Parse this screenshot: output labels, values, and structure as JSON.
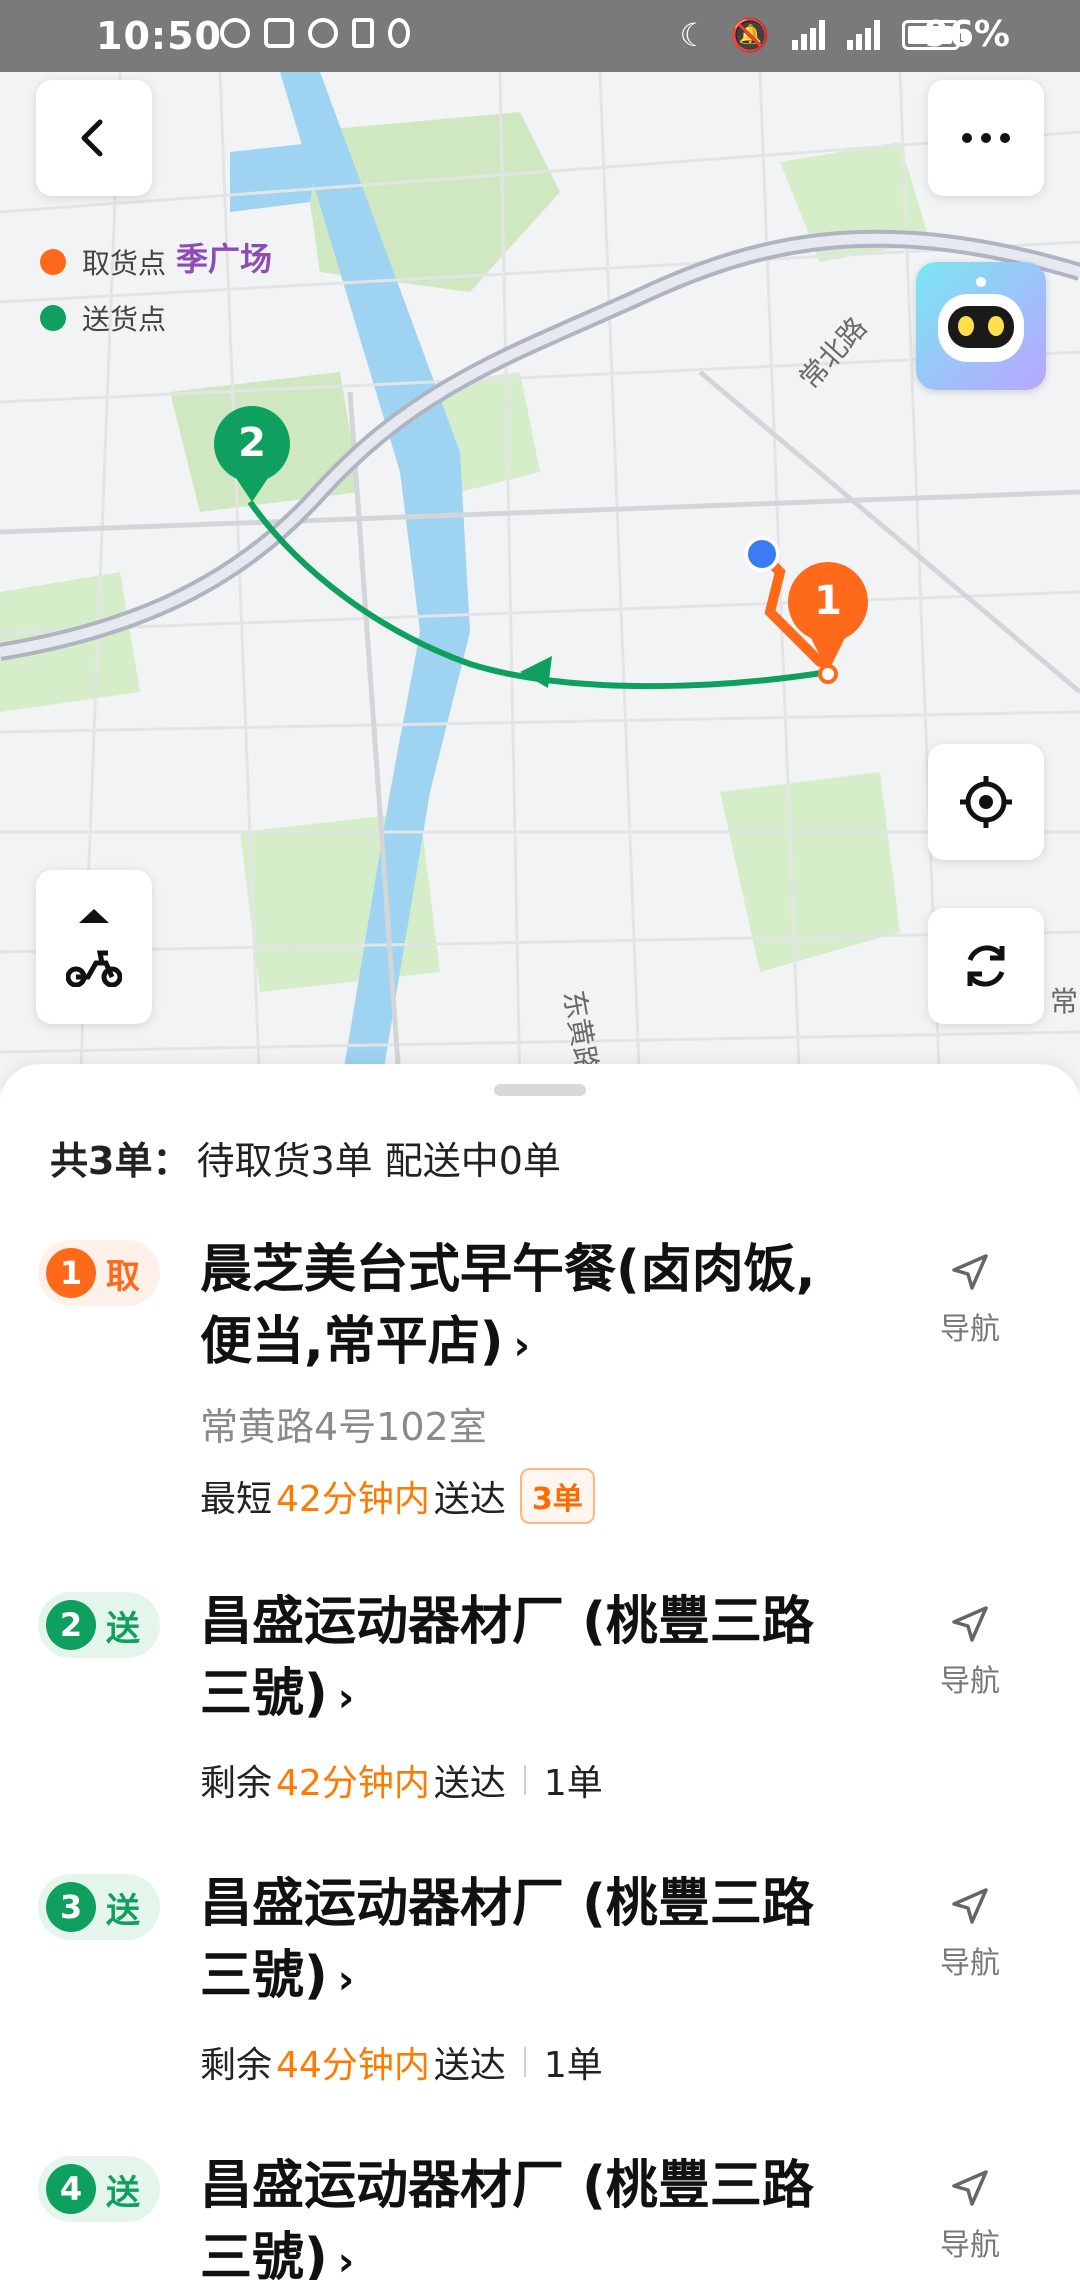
{
  "status_bar": {
    "time": "10:50",
    "battery": "96%"
  },
  "map": {
    "legend": {
      "pickup": "取货点",
      "delivery": "送货点"
    },
    "poi": "季广场",
    "road_labels": {
      "changbei": "常北路",
      "dongbei": "东黄路",
      "edge": "常"
    },
    "markers": [
      {
        "number": "1",
        "type": "pickup",
        "color": "#ff6a1a"
      },
      {
        "number": "2",
        "type": "delivery",
        "color": "#0fa060"
      }
    ]
  },
  "summary": {
    "total": "共3单：",
    "detail": "待取货3单 配送中0单"
  },
  "orders": [
    {
      "number": "1",
      "kind": "取",
      "name_line1": "晨芝美台式早午餐(卤肉饭,",
      "name_line2": "便当,常平店)",
      "arrow": "›",
      "address": "常黄路4号102室",
      "eta_prefix": "最短",
      "eta_time": "42分钟内",
      "eta_suffix": "送达",
      "count": "3单",
      "nav": "导航"
    },
    {
      "number": "2",
      "kind": "送",
      "name_line1": "昌盛运动器材厂 (桃豐三路",
      "name_line2": "三號)",
      "arrow": "›",
      "eta_prefix": "剩余",
      "eta_time": "42分钟内",
      "eta_suffix": "送达",
      "count": "1单",
      "nav": "导航"
    },
    {
      "number": "3",
      "kind": "送",
      "name_line1": "昌盛运动器材厂 (桃豐三路",
      "name_line2": "三號)",
      "arrow": "›",
      "eta_prefix": "剩余",
      "eta_time": "44分钟内",
      "eta_suffix": "送达",
      "count": "1单",
      "nav": "导航"
    },
    {
      "number": "4",
      "kind": "送",
      "name_line1": "昌盛运动器材厂 (桃豐三路",
      "name_line2": "三號)",
      "arrow": "›",
      "nav": "导航"
    }
  ]
}
